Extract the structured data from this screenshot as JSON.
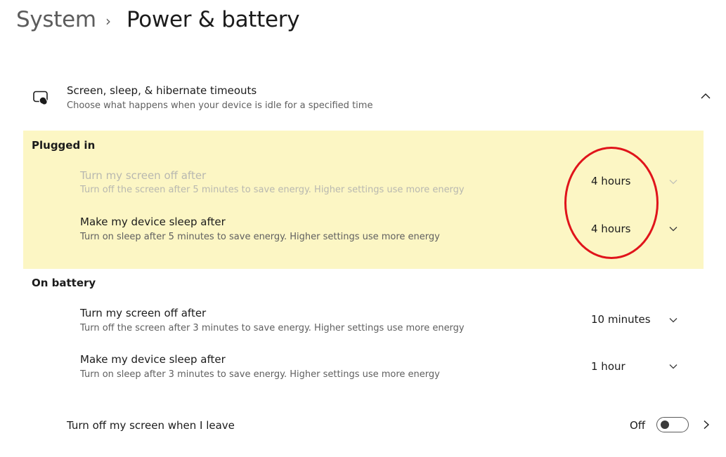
{
  "header": {
    "breadcrumb_root": "System",
    "breadcrumb_separator": "›",
    "page_title": "Power & battery"
  },
  "section": {
    "icon": "screen-sleep-icon",
    "title": "Screen, sleep, & hibernate timeouts",
    "subtitle": "Choose what happens when your device is idle for a specified time",
    "expanded": true
  },
  "plugged_in": {
    "label": "Plugged in",
    "highlight_color": "#fcf6c4",
    "rows": [
      {
        "title": "Turn my screen off after",
        "description": "Turn off the screen after 5 minutes to save energy. Higher settings use more energy",
        "value": "4 hours"
      },
      {
        "title": "Make my device sleep after",
        "description": "Turn on sleep after 5 minutes to save energy. Higher settings use more energy",
        "value": "4 hours"
      }
    ]
  },
  "on_battery": {
    "label": "On battery",
    "rows": [
      {
        "title": "Turn my screen off after",
        "description": "Turn off the screen after 3 minutes to save energy. Higher settings use more energy",
        "value": "10 minutes"
      },
      {
        "title": "Make my device sleep after",
        "description": "Turn on sleep after 3 minutes to save energy. Higher settings use more energy",
        "value": "1 hour"
      }
    ]
  },
  "leave_setting": {
    "title": "Turn off my screen when I leave",
    "state": "Off"
  },
  "annotation": {
    "color": "#e0141b"
  }
}
